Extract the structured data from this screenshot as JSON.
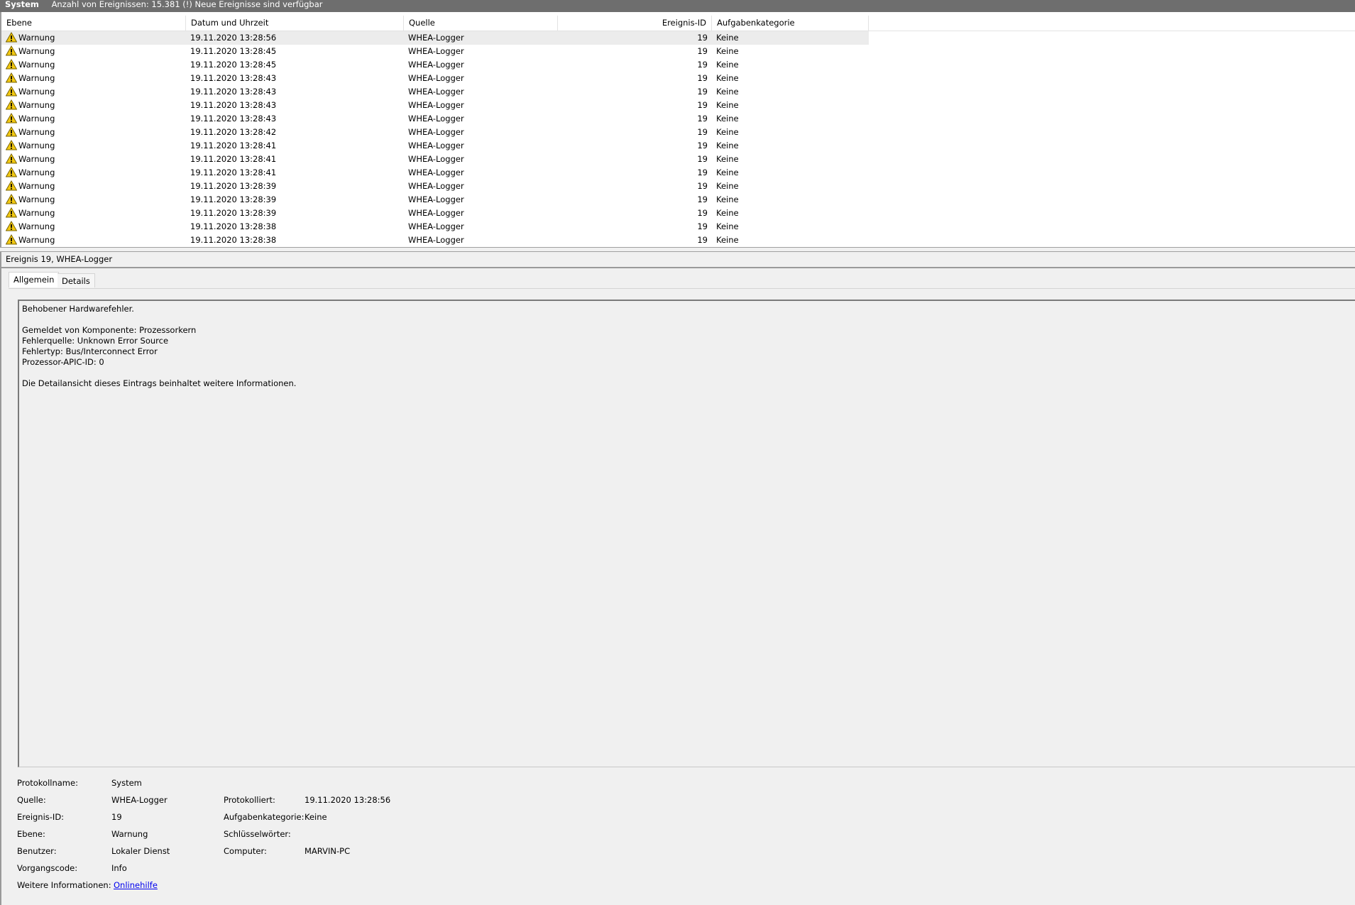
{
  "titlebar": {
    "name": "System",
    "status": "Anzahl von Ereignissen: 15.381 (!) Neue Ereignisse sind verfügbar"
  },
  "list": {
    "columns": [
      "Ebene",
      "Datum und Uhrzeit",
      "Quelle",
      "Ereignis-ID",
      "Aufgabenkategorie"
    ],
    "rows": [
      {
        "level": "Warnung",
        "date": "19.11.2020 13:28:56",
        "source": "WHEA-Logger",
        "event_id": "19",
        "category": "Keine"
      },
      {
        "level": "Warnung",
        "date": "19.11.2020 13:28:45",
        "source": "WHEA-Logger",
        "event_id": "19",
        "category": "Keine"
      },
      {
        "level": "Warnung",
        "date": "19.11.2020 13:28:45",
        "source": "WHEA-Logger",
        "event_id": "19",
        "category": "Keine"
      },
      {
        "level": "Warnung",
        "date": "19.11.2020 13:28:43",
        "source": "WHEA-Logger",
        "event_id": "19",
        "category": "Keine"
      },
      {
        "level": "Warnung",
        "date": "19.11.2020 13:28:43",
        "source": "WHEA-Logger",
        "event_id": "19",
        "category": "Keine"
      },
      {
        "level": "Warnung",
        "date": "19.11.2020 13:28:43",
        "source": "WHEA-Logger",
        "event_id": "19",
        "category": "Keine"
      },
      {
        "level": "Warnung",
        "date": "19.11.2020 13:28:43",
        "source": "WHEA-Logger",
        "event_id": "19",
        "category": "Keine"
      },
      {
        "level": "Warnung",
        "date": "19.11.2020 13:28:42",
        "source": "WHEA-Logger",
        "event_id": "19",
        "category": "Keine"
      },
      {
        "level": "Warnung",
        "date": "19.11.2020 13:28:41",
        "source": "WHEA-Logger",
        "event_id": "19",
        "category": "Keine"
      },
      {
        "level": "Warnung",
        "date": "19.11.2020 13:28:41",
        "source": "WHEA-Logger",
        "event_id": "19",
        "category": "Keine"
      },
      {
        "level": "Warnung",
        "date": "19.11.2020 13:28:41",
        "source": "WHEA-Logger",
        "event_id": "19",
        "category": "Keine"
      },
      {
        "level": "Warnung",
        "date": "19.11.2020 13:28:39",
        "source": "WHEA-Logger",
        "event_id": "19",
        "category": "Keine"
      },
      {
        "level": "Warnung",
        "date": "19.11.2020 13:28:39",
        "source": "WHEA-Logger",
        "event_id": "19",
        "category": "Keine"
      },
      {
        "level": "Warnung",
        "date": "19.11.2020 13:28:39",
        "source": "WHEA-Logger",
        "event_id": "19",
        "category": "Keine"
      },
      {
        "level": "Warnung",
        "date": "19.11.2020 13:28:38",
        "source": "WHEA-Logger",
        "event_id": "19",
        "category": "Keine"
      },
      {
        "level": "Warnung",
        "date": "19.11.2020 13:28:38",
        "source": "WHEA-Logger",
        "event_id": "19",
        "category": "Keine"
      }
    ]
  },
  "detail": {
    "title": "Ereignis 19, WHEA-Logger",
    "tabs": [
      "Allgemein",
      "Details"
    ],
    "description": "Behobener Hardwarefehler.\n\nGemeldet von Komponente: Prozessorkern\nFehlerquelle: Unknown Error Source\nFehlertyp: Bus/Interconnect Error\nProzessor-APIC-ID: 0\n\nDie Detailansicht dieses Eintrags beinhaltet weitere Informationen.",
    "props": {
      "log_name_label": "Protokollname:",
      "log_name": "System",
      "source_label": "Quelle:",
      "source": "WHEA-Logger",
      "logged_label": "Protokolliert:",
      "logged": "19.11.2020 13:28:56",
      "event_id_label": "Ereignis-ID:",
      "event_id": "19",
      "task_cat_label": "Aufgabenkategorie:",
      "task_cat": "Keine",
      "level_label": "Ebene:",
      "level": "Warnung",
      "keywords_label": "Schlüsselwörter:",
      "keywords": "",
      "user_label": "Benutzer:",
      "user": "Lokaler Dienst",
      "computer_label": "Computer:",
      "computer": "MARVIN-PC",
      "opcode_label": "Vorgangscode:",
      "opcode": "Info",
      "more_info_label": "Weitere Informationen:",
      "more_info_link": "Onlinehilfe"
    }
  },
  "colors": {
    "warning_icon": "#f2c811",
    "link": "#0000ee",
    "titlebar": "#6e6e6e"
  }
}
